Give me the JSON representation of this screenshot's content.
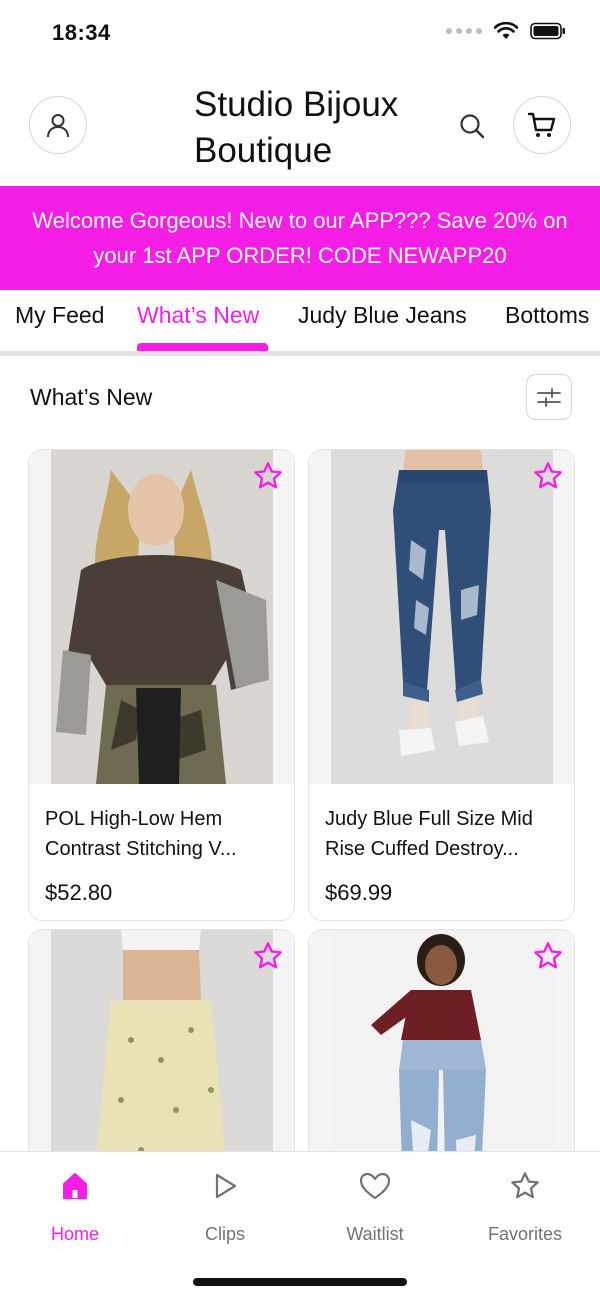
{
  "status_bar": {
    "time": "18:34"
  },
  "header": {
    "title_line1": "Studio Bijoux",
    "title_line2": "Boutique"
  },
  "promo": {
    "text": "Welcome Gorgeous! New to our APP??? Save 20% on your 1st APP ORDER! CODE NEWAPP20"
  },
  "tabs": [
    {
      "label": "My Feed"
    },
    {
      "label": "What’s New"
    },
    {
      "label": "Judy Blue Jeans"
    },
    {
      "label": "Bottoms"
    }
  ],
  "section": {
    "title": "What’s New"
  },
  "products": [
    {
      "name": "POL High-Low Hem Contrast Stitching V...",
      "price": "$52.80"
    },
    {
      "name": "Judy Blue Full Size Mid Rise Cuffed Destroy...",
      "price": "$69.99"
    },
    {
      "name": "",
      "price": ""
    },
    {
      "name": "",
      "price": ""
    }
  ],
  "bottom_nav": [
    {
      "label": "Home",
      "icon": "home-icon"
    },
    {
      "label": "Clips",
      "icon": "play-icon"
    },
    {
      "label": "Waitlist",
      "icon": "heart-icon"
    },
    {
      "label": "Favorites",
      "icon": "star-icon"
    }
  ],
  "colors": {
    "accent": "#f51ee6",
    "border": "#e4e4e7",
    "muted": "#71717a"
  }
}
